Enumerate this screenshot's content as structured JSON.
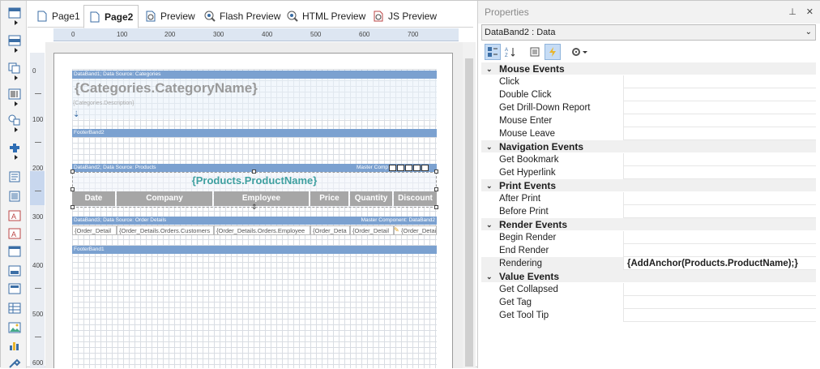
{
  "tabs": [
    {
      "label": "Page1",
      "icon": "page-icon"
    },
    {
      "label": "Page2",
      "icon": "page-icon",
      "active": true
    },
    {
      "label": "Preview",
      "icon": "preview-icon"
    },
    {
      "label": "Flash Preview",
      "icon": "flash-preview-icon"
    },
    {
      "label": "HTML Preview",
      "icon": "html-preview-icon"
    },
    {
      "label": "JS Preview",
      "icon": "js-preview-icon"
    }
  ],
  "ruler": {
    "h": [
      "0",
      "100",
      "200",
      "300",
      "400",
      "500",
      "600",
      "700"
    ],
    "v": [
      "0",
      "100",
      "200",
      "300",
      "400",
      "500",
      "600"
    ]
  },
  "report": {
    "databand1": "DataBand1; Data Source: Categories",
    "category_name": "{Categories.CategoryName}",
    "category_desc": "{Categories.Description}",
    "footer2": "FooterBand2",
    "databand2": "DataBand2; Data Source: Products",
    "databand2_master": "Master Comp",
    "product_name": "{Products.ProductName}",
    "headers": [
      "Date",
      "Company",
      "Employee",
      "Price",
      "Quantity",
      "Discount"
    ],
    "databand3": "DataBand3; Data Source: Order Details",
    "databand3_master": "Master Component: DataBand2",
    "cells": [
      "{Order_Detail",
      "{Order_Details.Orders.Customers",
      "{Order_Details.Orders.Employee",
      "{Order_Deta",
      "{Order_Detail",
      "{Order_Detail"
    ],
    "footer1": "FooterBand1"
  },
  "properties": {
    "title": "Properties",
    "pin": "⊥",
    "close": "✕",
    "object": "DataBand2 : Data",
    "categories": [
      {
        "name": "Mouse  Events",
        "items": [
          "Click",
          "Double Click",
          "Get Drill-Down Report",
          "Mouse Enter",
          "Mouse Leave"
        ]
      },
      {
        "name": "Navigation  Events",
        "items": [
          "Get Bookmark",
          "Get Hyperlink"
        ]
      },
      {
        "name": "Print  Events",
        "items": [
          "After Print",
          "Before Print"
        ]
      },
      {
        "name": "Render  Events",
        "items": [
          "Begin Render",
          "End Render",
          "Rendering"
        ]
      },
      {
        "name": "Value  Events",
        "items": [
          "Get Collapsed",
          "Get Tag",
          "Get Tool Tip"
        ]
      }
    ],
    "rendering_value": "{AddAnchor(Products.ProductName);}"
  },
  "colors": {
    "band": "#7ba1d0",
    "accent_text": "#3fa0a0",
    "header_cell": "#a6a6a6"
  }
}
